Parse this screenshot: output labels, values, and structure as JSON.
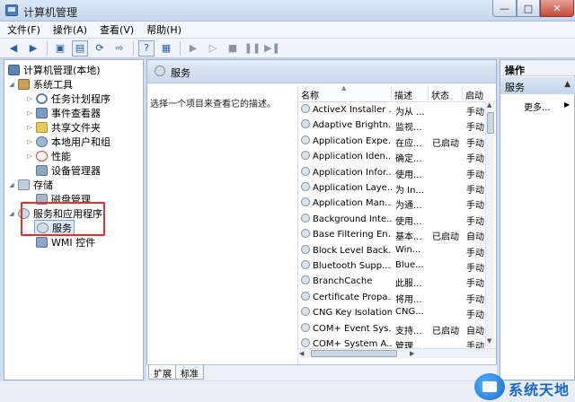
{
  "window": {
    "title": "计算机管理"
  },
  "menu": [
    "文件(F)",
    "操作(A)",
    "查看(V)",
    "帮助(H)"
  ],
  "toolbar": {
    "buttons": [
      "back-icon",
      "forward-icon",
      "up-folder-icon",
      "show-hide-tree-icon",
      "refresh-icon",
      "export-icon",
      "help-icon",
      "properties-icon",
      "play-icon",
      "play-alt-icon",
      "stop-icon",
      "pause-icon",
      "restart-icon"
    ]
  },
  "tree": {
    "root": "计算机管理(本地)",
    "system_tools": "系统工具",
    "task_scheduler": "任务计划程序",
    "event_viewer": "事件查看器",
    "shared_folders": "共享文件夹",
    "local_users": "本地用户和组",
    "performance": "性能",
    "device_manager": "设备管理器",
    "storage": "存储",
    "disk_mgmt": "磁盘管理",
    "services_apps": "服务和应用程序",
    "services": "服务",
    "wmi": "WMI 控件"
  },
  "center": {
    "header_title": "服务",
    "description": "选择一个项目来查看它的描述。",
    "columns": [
      "名称",
      "描述",
      "状态",
      "启动"
    ],
    "rows": [
      {
        "name": "ActiveX Installer ...",
        "desc": "为从 ...",
        "status": "",
        "start": "手动"
      },
      {
        "name": "Adaptive Brightn...",
        "desc": "监视...",
        "status": "",
        "start": "手动"
      },
      {
        "name": "Application Expe...",
        "desc": "在应...",
        "status": "已启动",
        "start": "手动"
      },
      {
        "name": "Application Iden...",
        "desc": "确定...",
        "status": "",
        "start": "手动"
      },
      {
        "name": "Application Infor...",
        "desc": "使用...",
        "status": "",
        "start": "手动"
      },
      {
        "name": "Application Laye...",
        "desc": "为 In...",
        "status": "",
        "start": "手动"
      },
      {
        "name": "Application Man...",
        "desc": "为通...",
        "status": "",
        "start": "手动"
      },
      {
        "name": "Background Inte...",
        "desc": "使用...",
        "status": "",
        "start": "手动"
      },
      {
        "name": "Base Filtering En...",
        "desc": "基本...",
        "status": "已启动",
        "start": "自动"
      },
      {
        "name": "Block Level Back...",
        "desc": "Win...",
        "status": "",
        "start": "手动"
      },
      {
        "name": "Bluetooth Supp...",
        "desc": "Blue...",
        "status": "",
        "start": "手动"
      },
      {
        "name": "BranchCache",
        "desc": "此服...",
        "status": "",
        "start": "手动"
      },
      {
        "name": "Certificate Propa...",
        "desc": "将用...",
        "status": "",
        "start": "手动"
      },
      {
        "name": "CNG Key Isolation",
        "desc": "CNG...",
        "status": "",
        "start": "手动"
      },
      {
        "name": "COM+ Event Sys...",
        "desc": "支持...",
        "status": "已启动",
        "start": "自动"
      },
      {
        "name": "COM+ System A...",
        "desc": "管理...",
        "status": "",
        "start": "手动"
      }
    ]
  },
  "tabs": [
    "扩展",
    "标准"
  ],
  "actions": {
    "title": "操作",
    "section": "服务",
    "more": "更多..."
  },
  "watermark": {
    "text": "系统天地"
  }
}
